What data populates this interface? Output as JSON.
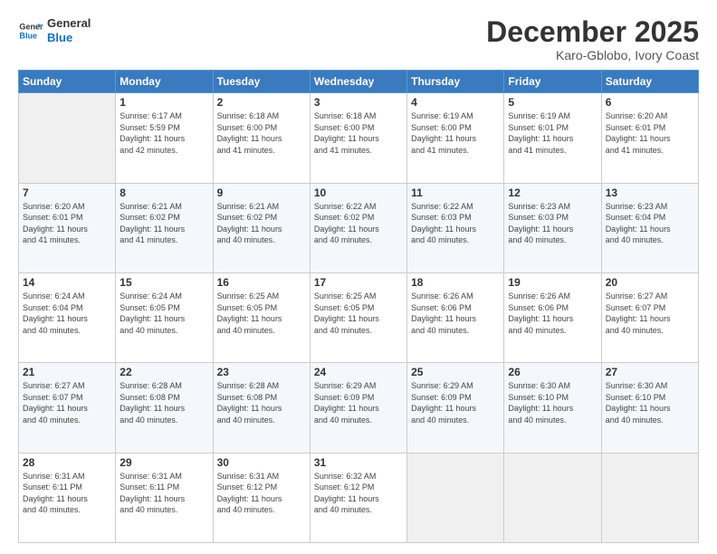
{
  "header": {
    "logo_line1": "General",
    "logo_line2": "Blue",
    "month": "December 2025",
    "location": "Karo-Gblobo, Ivory Coast"
  },
  "days_of_week": [
    "Sunday",
    "Monday",
    "Tuesday",
    "Wednesday",
    "Thursday",
    "Friday",
    "Saturday"
  ],
  "weeks": [
    [
      {
        "num": "",
        "info": ""
      },
      {
        "num": "1",
        "info": "Sunrise: 6:17 AM\nSunset: 5:59 PM\nDaylight: 11 hours\nand 42 minutes."
      },
      {
        "num": "2",
        "info": "Sunrise: 6:18 AM\nSunset: 6:00 PM\nDaylight: 11 hours\nand 41 minutes."
      },
      {
        "num": "3",
        "info": "Sunrise: 6:18 AM\nSunset: 6:00 PM\nDaylight: 11 hours\nand 41 minutes."
      },
      {
        "num": "4",
        "info": "Sunrise: 6:19 AM\nSunset: 6:00 PM\nDaylight: 11 hours\nand 41 minutes."
      },
      {
        "num": "5",
        "info": "Sunrise: 6:19 AM\nSunset: 6:01 PM\nDaylight: 11 hours\nand 41 minutes."
      },
      {
        "num": "6",
        "info": "Sunrise: 6:20 AM\nSunset: 6:01 PM\nDaylight: 11 hours\nand 41 minutes."
      }
    ],
    [
      {
        "num": "7",
        "info": "Sunrise: 6:20 AM\nSunset: 6:01 PM\nDaylight: 11 hours\nand 41 minutes."
      },
      {
        "num": "8",
        "info": "Sunrise: 6:21 AM\nSunset: 6:02 PM\nDaylight: 11 hours\nand 41 minutes."
      },
      {
        "num": "9",
        "info": "Sunrise: 6:21 AM\nSunset: 6:02 PM\nDaylight: 11 hours\nand 40 minutes."
      },
      {
        "num": "10",
        "info": "Sunrise: 6:22 AM\nSunset: 6:02 PM\nDaylight: 11 hours\nand 40 minutes."
      },
      {
        "num": "11",
        "info": "Sunrise: 6:22 AM\nSunset: 6:03 PM\nDaylight: 11 hours\nand 40 minutes."
      },
      {
        "num": "12",
        "info": "Sunrise: 6:23 AM\nSunset: 6:03 PM\nDaylight: 11 hours\nand 40 minutes."
      },
      {
        "num": "13",
        "info": "Sunrise: 6:23 AM\nSunset: 6:04 PM\nDaylight: 11 hours\nand 40 minutes."
      }
    ],
    [
      {
        "num": "14",
        "info": "Sunrise: 6:24 AM\nSunset: 6:04 PM\nDaylight: 11 hours\nand 40 minutes."
      },
      {
        "num": "15",
        "info": "Sunrise: 6:24 AM\nSunset: 6:05 PM\nDaylight: 11 hours\nand 40 minutes."
      },
      {
        "num": "16",
        "info": "Sunrise: 6:25 AM\nSunset: 6:05 PM\nDaylight: 11 hours\nand 40 minutes."
      },
      {
        "num": "17",
        "info": "Sunrise: 6:25 AM\nSunset: 6:05 PM\nDaylight: 11 hours\nand 40 minutes."
      },
      {
        "num": "18",
        "info": "Sunrise: 6:26 AM\nSunset: 6:06 PM\nDaylight: 11 hours\nand 40 minutes."
      },
      {
        "num": "19",
        "info": "Sunrise: 6:26 AM\nSunset: 6:06 PM\nDaylight: 11 hours\nand 40 minutes."
      },
      {
        "num": "20",
        "info": "Sunrise: 6:27 AM\nSunset: 6:07 PM\nDaylight: 11 hours\nand 40 minutes."
      }
    ],
    [
      {
        "num": "21",
        "info": "Sunrise: 6:27 AM\nSunset: 6:07 PM\nDaylight: 11 hours\nand 40 minutes."
      },
      {
        "num": "22",
        "info": "Sunrise: 6:28 AM\nSunset: 6:08 PM\nDaylight: 11 hours\nand 40 minutes."
      },
      {
        "num": "23",
        "info": "Sunrise: 6:28 AM\nSunset: 6:08 PM\nDaylight: 11 hours\nand 40 minutes."
      },
      {
        "num": "24",
        "info": "Sunrise: 6:29 AM\nSunset: 6:09 PM\nDaylight: 11 hours\nand 40 minutes."
      },
      {
        "num": "25",
        "info": "Sunrise: 6:29 AM\nSunset: 6:09 PM\nDaylight: 11 hours\nand 40 minutes."
      },
      {
        "num": "26",
        "info": "Sunrise: 6:30 AM\nSunset: 6:10 PM\nDaylight: 11 hours\nand 40 minutes."
      },
      {
        "num": "27",
        "info": "Sunrise: 6:30 AM\nSunset: 6:10 PM\nDaylight: 11 hours\nand 40 minutes."
      }
    ],
    [
      {
        "num": "28",
        "info": "Sunrise: 6:31 AM\nSunset: 6:11 PM\nDaylight: 11 hours\nand 40 minutes."
      },
      {
        "num": "29",
        "info": "Sunrise: 6:31 AM\nSunset: 6:11 PM\nDaylight: 11 hours\nand 40 minutes."
      },
      {
        "num": "30",
        "info": "Sunrise: 6:31 AM\nSunset: 6:12 PM\nDaylight: 11 hours\nand 40 minutes."
      },
      {
        "num": "31",
        "info": "Sunrise: 6:32 AM\nSunset: 6:12 PM\nDaylight: 11 hours\nand 40 minutes."
      },
      {
        "num": "",
        "info": ""
      },
      {
        "num": "",
        "info": ""
      },
      {
        "num": "",
        "info": ""
      }
    ]
  ]
}
